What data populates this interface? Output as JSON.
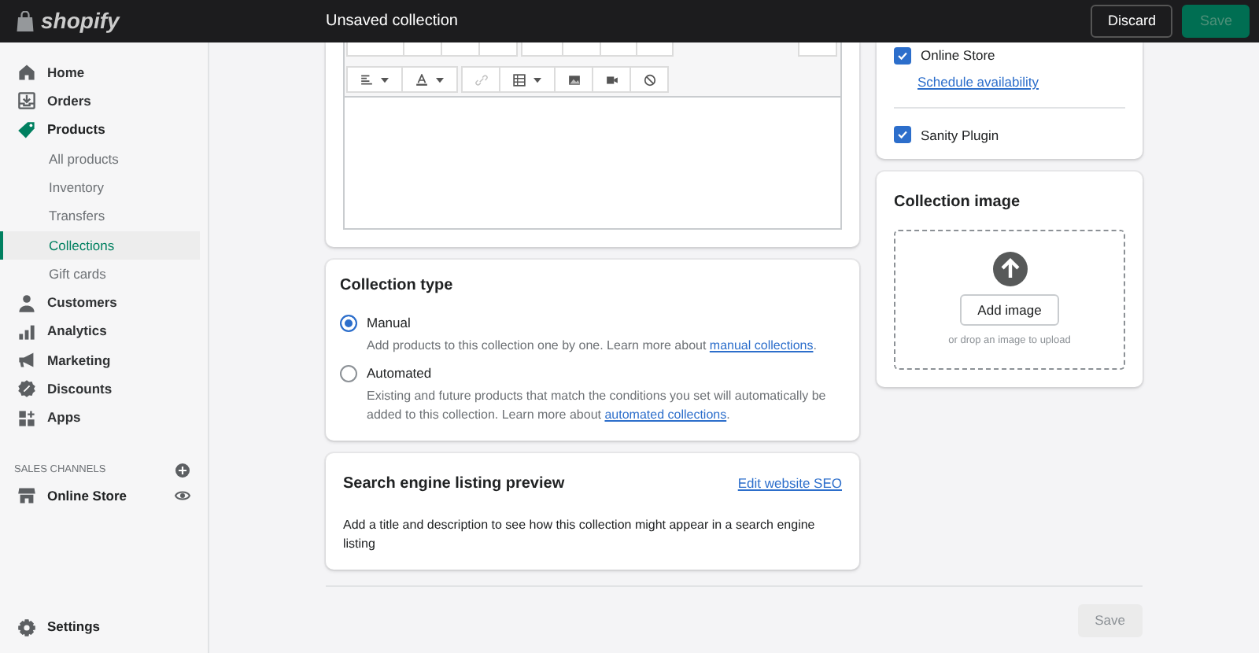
{
  "top_bar": {
    "logo": "shopify",
    "title": "Unsaved collection",
    "buttons": [
      {
        "label": "Discard",
        "kind": "secondary"
      },
      {
        "label": "Save",
        "kind": "primary",
        "disabled": true
      }
    ]
  },
  "sidebar": {
    "items": [
      {
        "label": "Home",
        "kind": "home",
        "selected": false
      },
      {
        "label": "Orders",
        "kind": "orders",
        "selected": false
      },
      {
        "label": "Products",
        "kind": "tag",
        "selected": true,
        "children": [
          {
            "label": "All products",
            "selected": false
          },
          {
            "label": "Inventory",
            "selected": false
          },
          {
            "label": "Transfers",
            "selected": false
          },
          {
            "label": "Collections",
            "selected": true
          },
          {
            "label": "Gift cards",
            "selected": false
          }
        ]
      },
      {
        "label": "Customers",
        "kind": "person",
        "selected": false
      },
      {
        "label": "Analytics",
        "kind": "bars",
        "selected": false
      },
      {
        "label": "Marketing",
        "kind": "megaphone",
        "selected": false
      },
      {
        "label": "Discounts",
        "kind": "discount",
        "selected": false
      },
      {
        "label": "Apps",
        "kind": "apps",
        "selected": false
      }
    ],
    "sales_channels": {
      "heading": "SALES CHANNELS",
      "items": [
        {
          "label": "Online Store",
          "kind": "store"
        }
      ]
    },
    "settings": {
      "label": "Settings"
    }
  },
  "editor": {
    "toolbar": [
      [
        {
          "kind": "align",
          "dropdown": true,
          "disabled": false
        },
        {
          "kind": "text-color",
          "dropdown": true,
          "disabled": false
        }
      ],
      [
        {
          "kind": "link",
          "dropdown": false,
          "disabled": true
        },
        {
          "kind": "table",
          "dropdown": true,
          "disabled": false
        },
        {
          "kind": "image",
          "dropdown": false,
          "disabled": false
        },
        {
          "kind": "video",
          "dropdown": false,
          "disabled": false
        },
        {
          "kind": "clear",
          "dropdown": false,
          "disabled": false
        }
      ]
    ]
  },
  "collection_type": {
    "title": "Collection type",
    "options": [
      {
        "label": "Manual",
        "selected": true,
        "description": "Add products to this collection one by one. Learn more about",
        "link": "manual collections",
        "after": "."
      },
      {
        "label": "Automated",
        "selected": false,
        "description": "Existing and future products that match the conditions you set will automatically be added to this collection. Learn more about",
        "link": "automated collections",
        "after": "."
      }
    ]
  },
  "seo": {
    "title": "Search engine listing preview",
    "action": "Edit website SEO",
    "text": "Add a title and description to see how this collection might appear in a search engine listing"
  },
  "channels": [
    {
      "label": "Online Store",
      "checked": true,
      "link": "Schedule availability"
    },
    {
      "label": "Sanity Plugin",
      "checked": true
    }
  ],
  "collection_image": {
    "title": "Collection image",
    "button": "Add image",
    "hint": "or drop an image to upload"
  },
  "footer": {
    "button": {
      "label": "Save",
      "disabled": true
    }
  }
}
